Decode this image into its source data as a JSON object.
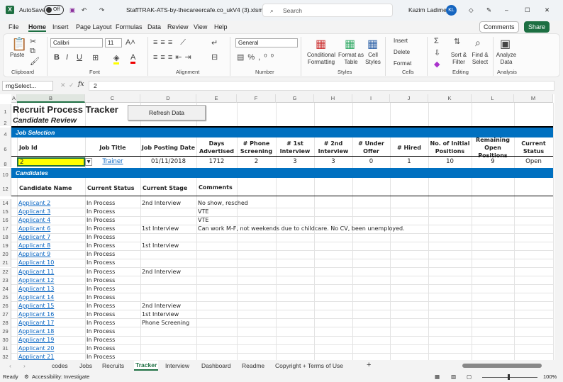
{
  "titlebar": {
    "autosave_label": "AutoSave",
    "autosave_state": "Off",
    "filename": "StaffTRAK-ATS-by-thecareercafe.co_ukV4 (3).xlsm  -...",
    "search_placeholder": "Search",
    "user": "Kazim Ladimeji",
    "initials": "KL"
  },
  "menu": {
    "items": [
      "File",
      "Home",
      "Insert",
      "Page Layout",
      "Formulas",
      "Data",
      "Review",
      "View",
      "Help"
    ],
    "comments": "Comments",
    "share": "Share"
  },
  "ribbon": {
    "paste": "Paste",
    "clipboard": "Clipboard",
    "font_name": "Calibri",
    "font_size": "11",
    "font": "Font",
    "alignment": "Alignment",
    "number_format": "General",
    "number": "Number",
    "conditional": "Conditional Formatting",
    "format_table": "Format as Table",
    "cell_styles": "Cell Styles",
    "styles": "Styles",
    "insert": "Insert",
    "delete": "Delete",
    "format": "Format",
    "cells": "Cells",
    "sort": "Sort & Filter",
    "find": "Find & Select",
    "editing": "Editing",
    "analyze": "Analyze Data",
    "analysis": "Analysis"
  },
  "formula_bar": {
    "name_box": "rngSelect...",
    "value": "2"
  },
  "columns": [
    "A",
    "B",
    "C",
    "D",
    "E",
    "F",
    "G",
    "H",
    "I",
    "J",
    "K",
    "L",
    "M"
  ],
  "sheet": {
    "title": "Recruit Process Tracker",
    "subtitle": "Candidate Review",
    "refresh_button": "Refresh Data",
    "job_section": "Job Selection",
    "job_headers": [
      "Job Id",
      "Job Title",
      "Job Posting Date",
      "Days Advertised",
      "# Phone Screening",
      "# 1st Interview",
      "# 2nd Interview",
      "# Under Offer",
      "# Hired",
      "No. of Initial Positions",
      "Remaining Open Positions",
      "Current Status"
    ],
    "job_row": [
      "2",
      "Trainer",
      "01/11/2018",
      "1712",
      "2",
      "3",
      "3",
      "0",
      "1",
      "10",
      "9",
      "Open"
    ],
    "candidates_section": "Candidates",
    "cand_headers": [
      "Candidate Name",
      "Current Status",
      "Current Stage",
      "Comments"
    ],
    "candidates": [
      {
        "row": "14",
        "name": "Applicant 2",
        "status": "In Process",
        "stage": "2nd Interview",
        "comment": "No show, resched"
      },
      {
        "row": "15",
        "name": "Applicant 3",
        "status": "In Process",
        "stage": "",
        "comment": "VTE"
      },
      {
        "row": "16",
        "name": "Applicant 4",
        "status": "In Process",
        "stage": "",
        "comment": "VTE"
      },
      {
        "row": "17",
        "name": "Applicant 6",
        "status": "In Process",
        "stage": "1st Interview",
        "comment": "Can work M-F, not weekends due to childcare.  No CV, been unemployed."
      },
      {
        "row": "18",
        "name": "Applicant 7",
        "status": "In Process",
        "stage": "",
        "comment": ""
      },
      {
        "row": "19",
        "name": "Applicant 8",
        "status": "In Process",
        "stage": "1st Interview",
        "comment": ""
      },
      {
        "row": "20",
        "name": "Applicant 9",
        "status": "In Process",
        "stage": "",
        "comment": ""
      },
      {
        "row": "21",
        "name": "Applicant 10",
        "status": "In Process",
        "stage": "",
        "comment": ""
      },
      {
        "row": "22",
        "name": "Applicant 11",
        "status": "In Process",
        "stage": "2nd Interview",
        "comment": ""
      },
      {
        "row": "23",
        "name": "Applicant 12",
        "status": "In Process",
        "stage": "",
        "comment": ""
      },
      {
        "row": "24",
        "name": "Applicant 13",
        "status": "In Process",
        "stage": "",
        "comment": ""
      },
      {
        "row": "25",
        "name": "Applicant 14",
        "status": "In Process",
        "stage": "",
        "comment": ""
      },
      {
        "row": "26",
        "name": "Applicant 15",
        "status": "In Process",
        "stage": "2nd Interview",
        "comment": ""
      },
      {
        "row": "27",
        "name": "Applicant 16",
        "status": "In Process",
        "stage": "1st Interview",
        "comment": ""
      },
      {
        "row": "28",
        "name": "Applicant 17",
        "status": "In Process",
        "stage": "Phone Screening",
        "comment": ""
      },
      {
        "row": "29",
        "name": "Applicant 18",
        "status": "In Process",
        "stage": "",
        "comment": ""
      },
      {
        "row": "30",
        "name": "Applicant 19",
        "status": "In Process",
        "stage": "",
        "comment": ""
      },
      {
        "row": "31",
        "name": "Applicant 20",
        "status": "In Process",
        "stage": "",
        "comment": ""
      },
      {
        "row": "32",
        "name": "Applicant 21",
        "status": "In Process",
        "stage": "",
        "comment": ""
      }
    ]
  },
  "row_labels": {
    "r1": "1",
    "r2": "2",
    "r4": "4",
    "r6": "6",
    "r8": "8",
    "r10": "10",
    "r12": "12"
  },
  "tabs": [
    "codes",
    "Jobs",
    "Recruits",
    "Tracker",
    "Interview",
    "Dashboard",
    "Readme",
    "Copyright + Terms of Use"
  ],
  "status": {
    "ready": "Ready",
    "accessibility": "Accessibility: Investigate",
    "zoom": "100%"
  },
  "colors": {
    "accent": "#0070c0",
    "excel_green": "#1d6f42",
    "selected_cell": "#ffff00"
  }
}
